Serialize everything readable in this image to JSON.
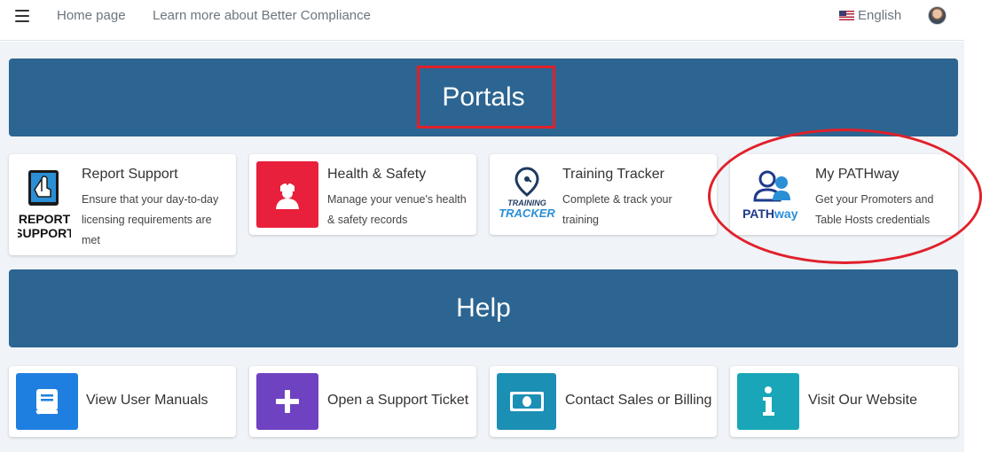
{
  "nav": {
    "home": "Home page",
    "learn_more": "Learn more about Better Compliance",
    "language": "English"
  },
  "banners": {
    "portals": "Portals",
    "help": "Help"
  },
  "portals": [
    {
      "title": "Report Support",
      "desc": "Ensure that your day-to-day licensing requirements are met",
      "logo_line1": "REPORT",
      "logo_line2": "SUPPORT"
    },
    {
      "title": "Health & Safety",
      "desc": "Manage your venue's health & safety records",
      "color": "#e8203c"
    },
    {
      "title": "Training Tracker",
      "desc": "Complete & track your training",
      "logo_line1": "TRAINING",
      "logo_line2": "TRACKER"
    },
    {
      "title": "My PATHway",
      "desc": "Get your Promoters and Table Hosts credentials",
      "logo_a": "PATH",
      "logo_b": "way"
    }
  ],
  "help": [
    {
      "label": "View User Manuals",
      "icon": "book-icon",
      "color": "#1f7fe0"
    },
    {
      "label": "Open a Support Ticket",
      "icon": "plus-icon",
      "color": "#6f42c1"
    },
    {
      "label": "Contact Sales or Billing",
      "icon": "money-icon",
      "color": "#1c8fb5"
    },
    {
      "label": "Visit Our Website",
      "icon": "info-icon",
      "color": "#19a6b8"
    }
  ],
  "colors": {
    "banner": "#2c6591",
    "annotation": "#e0202a",
    "page_bg": "#f0f3f7"
  }
}
